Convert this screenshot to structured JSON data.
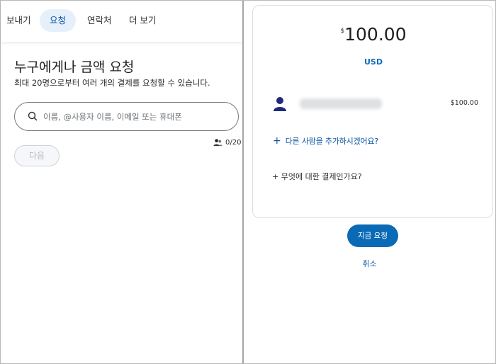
{
  "tabs": [
    {
      "label": "보내기"
    },
    {
      "label": "요청"
    },
    {
      "label": "연락처"
    },
    {
      "label": "더 보기"
    }
  ],
  "request_form": {
    "title": "누구에게나 금액 요청",
    "subtitle": "최대 20명으로부터 여러 개의 결제를 요청할 수 있습니다.",
    "search_placeholder": "이름, @사용자 이름, 이메일 또는 휴대폰",
    "recipient_count": "0/20",
    "next_label": "다음"
  },
  "summary": {
    "currency_symbol": "$",
    "amount": "100.00",
    "currency": "USD",
    "recipient_amount": "$100.00",
    "add_person_label": "다른 사람을 추가하시겠어요?",
    "add_note_label": "+ 무엇에 대한 결제인가요?",
    "request_now_label": "지금 요청",
    "cancel_label": "취소"
  },
  "colors": {
    "accent_blue": "#0a6ab5",
    "link_blue": "#0b57a4",
    "active_tab_bg": "#e6f0fb",
    "avatar_navy": "#1e2a78"
  },
  "icons": {
    "search": "search-icon",
    "contacts": "people-icon",
    "avatar": "user-avatar-icon",
    "add": "plus-icon"
  }
}
